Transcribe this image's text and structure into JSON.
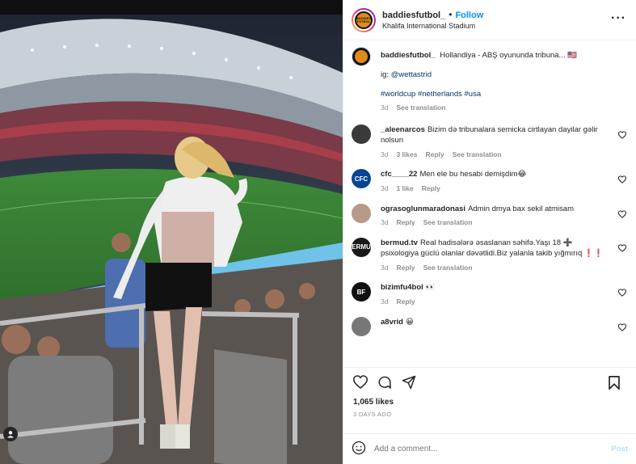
{
  "header": {
    "username": "baddiesfutbol_",
    "separator": "•",
    "follow_label": "Follow",
    "location": "Khalifa International Stadium",
    "more_label": "···",
    "avatar_logo_text": "BADDIES FUTBOL"
  },
  "caption": {
    "username": "baddiesfutbol_",
    "text": "Hollandiya - ABŞ oyununda tribuna... 🇺🇸",
    "ig_prefix": "ig:",
    "ig_handle": "@wettastrid",
    "hashtags": "#worldcup #netherlands #usa",
    "time": "3d",
    "see_translation": "See translation"
  },
  "comments": [
    {
      "username": "_aleenarcos",
      "text": "Bizim də tribunalara semicka cirtlayan dayilar gəlir nolsun",
      "time": "3d",
      "likes": "3 likes",
      "reply": "Reply",
      "see_translation": "See translation",
      "avatar_color": "#3a3a3a",
      "avatar_text": ""
    },
    {
      "username": "cfc____22",
      "text": "Men ele bu hesabi demişdim😂",
      "time": "3d",
      "likes": "1 like",
      "reply": "Reply",
      "see_translation": "",
      "avatar_color": "#034694",
      "avatar_text": "CFC"
    },
    {
      "username": "ograsoglunmaradonasi",
      "text": "Admin dmya bax sekil atmisam",
      "time": "3d",
      "likes": "",
      "reply": "Reply",
      "see_translation": "See translation",
      "avatar_color": "#b89a8a",
      "avatar_text": ""
    },
    {
      "username": "bermud.tv",
      "text": "Real hadisələrə əsaslanan səhifə.Yaşı 18 ➕ psixologiya güclü olanlar dəvətlidi.Biz yalanla takib yığmırıq ❗❗",
      "time": "3d",
      "likes": "",
      "reply": "Reply",
      "see_translation": "See translation",
      "avatar_color": "#1a1a1a",
      "avatar_text": "BERMUD"
    },
    {
      "username": "bizimfu4bol",
      "text": "👀",
      "time": "3d",
      "likes": "",
      "reply": "Reply",
      "see_translation": "",
      "avatar_color": "#111111",
      "avatar_text": "BF"
    },
    {
      "username": "a8vrid",
      "text": "😀",
      "time": "",
      "likes": "",
      "reply": "",
      "see_translation": "",
      "avatar_color": "#777777",
      "avatar_text": ""
    }
  ],
  "actions": {
    "likes": "1,065 likes",
    "date": "3 DAYS AGO"
  },
  "add_comment": {
    "placeholder": "Add a comment...",
    "post_label": "Post"
  },
  "media": {
    "tag_icon": "person-icon"
  }
}
